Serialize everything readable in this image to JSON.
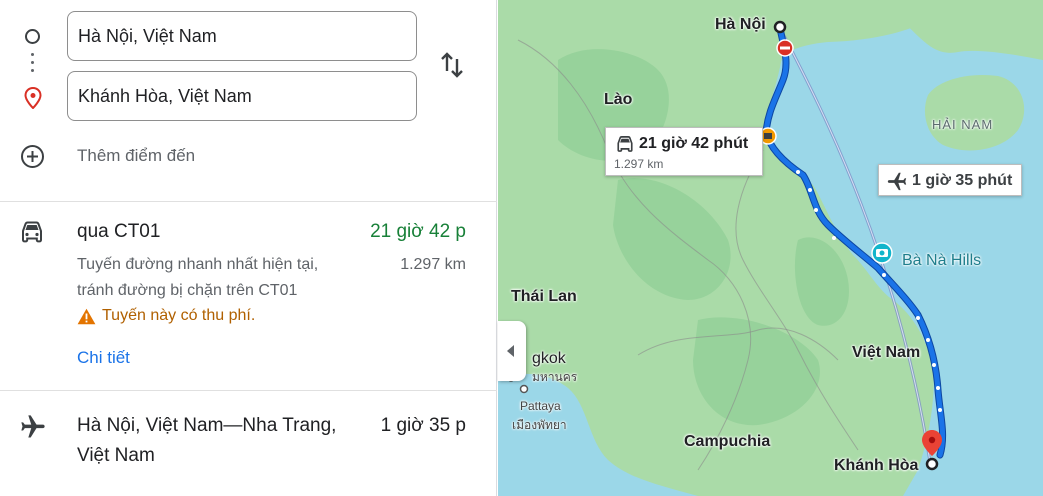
{
  "directions": {
    "origin_value": "Hà Nội, Việt Nam",
    "destination_value": "Khánh Hòa, Việt Nam",
    "add_destination_label": "Thêm điểm đến"
  },
  "routes": {
    "driving": {
      "title": "qua CT01",
      "duration": "21 giờ 42 p",
      "distance": "1.297 km",
      "description_line1": "Tuyến đường nhanh nhất hiện tại,",
      "description_line2": "tránh đường bị chặn trên CT01",
      "warning": "Tuyến này có thu phí.",
      "details_link": "Chi tiết"
    },
    "flight": {
      "title_line1": "Hà Nội, Việt Nam—Nha Trang,",
      "title_line2": "Việt Nam",
      "duration": "1 giờ 35 p"
    }
  },
  "map": {
    "labels": {
      "hanoi": "Hà Nội",
      "laos": "Lào",
      "hainam": "HẢI NAM",
      "thailand": "Thái Lan",
      "bangkok_partial": "gkok",
      "bangkok_thai_partial": "มหานคร",
      "pattaya": "Pattaya",
      "pattaya_thai": "เมืองพัทยา",
      "vietnam": "Việt Nam",
      "cambodia": "Campuchia",
      "khanhhoa": "Khánh Hòa",
      "banahills": "Bà Nà Hills"
    },
    "car_info": {
      "duration": "21 giờ 42 phút",
      "distance": "1.297 km"
    },
    "flight_info": {
      "duration": "1 giờ 35 phút"
    }
  },
  "colors": {
    "route_blue": "#1a73e8",
    "time_green": "#188038",
    "link_blue": "#1a73e8",
    "warning_orange": "#e37400",
    "pin_red": "#ea4335",
    "land_green": "#aadba8",
    "water_blue": "#9bd7e8"
  },
  "icons": {
    "origin": "circle-outline-icon",
    "destination": "location-pin-icon",
    "swap": "swap-vertical-icon",
    "add": "add-circle-icon",
    "car": "car-icon",
    "warning": "warning-icon",
    "plane": "airplane-icon",
    "collapse": "chevron-left-icon"
  }
}
